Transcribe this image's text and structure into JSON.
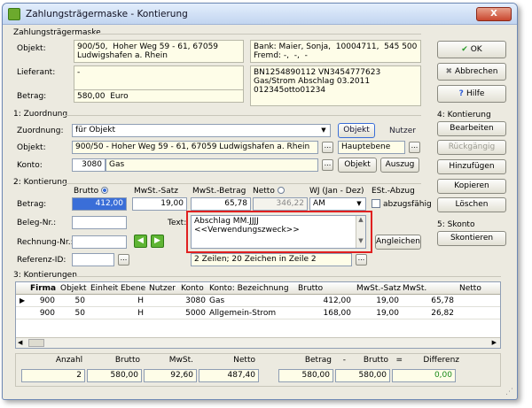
{
  "title": "Zahlungsträgermaske - Kontierung",
  "close": "X",
  "zm": {
    "group": "Zahlungsträgermaske",
    "objekt_label": "Objekt:",
    "objekt_value": "900/50,  Hoher Weg 59 - 61, 67059\nLudwigshafen a. Rhein",
    "bank_value": "Bank: Maier, Sonja,  10004711,  545 500 10,  S\nFremd: -,  -,  -",
    "lieferant_label": "Lieferant:",
    "lieferant_value": "-",
    "info_value": "BN1254890112 VN3454777623\nGas/Strom Abschlag 03.2011\n012345otto01234",
    "betrag_label": "Betrag:",
    "betrag_value": "580,00  Euro"
  },
  "z": {
    "group": "1: Zuordnung",
    "zuordnung_label": "Zuordnung:",
    "zuordnung_value": "für Objekt",
    "tab_objekt": "Objekt",
    "tab_nutzer": "Nutzer",
    "objekt_label": "Objekt:",
    "objekt_value": "900/50 - Hoher Weg 59 - 61, 67059 Ludwigshafen a. Rhein",
    "ebene_value": "Hauptebene",
    "konto_label": "Konto:",
    "konto_num": "3080",
    "konto_name": "Gas",
    "objekt_btn": "Objekt",
    "auszug_btn": "Auszug"
  },
  "k": {
    "group": "2: Kontierung",
    "h_brutto": "Brutto",
    "h_mwstsatz": "MwSt.-Satz",
    "h_mwstbetrag": "MwSt.-Betrag",
    "h_netto": "Netto",
    "h_wj": "WJ  (Jan - Dez)",
    "h_est": "ESt.-Abzug",
    "betrag_label": "Betrag:",
    "brutto": "412,00",
    "satz": "19,00",
    "mwst": "65,78",
    "netto": "346,22",
    "wj": "AM",
    "abzug": "abzugsfähig",
    "beleg_label": "Beleg-Nr.:",
    "text_label": "Text:",
    "text_value": "Abschlag MM.JJJJ\n<<Verwendungszweck>>",
    "rechnung_label": "Rechnung-Nr.:",
    "angleichen": "Angleichen",
    "referenz_label": "Referenz-ID:",
    "zeilen_info": "2 Zeilen; 20 Zeichen in Zeile 2"
  },
  "list": {
    "group": "3: Kontierungen",
    "headers": [
      "Firma",
      "Objekt",
      "Einheit",
      "Ebene",
      "Nutzer",
      "Konto",
      "Konto: Bezeichnung",
      "Brutto",
      "MwSt.-Satz",
      "MwSt.",
      "Netto"
    ],
    "rows": [
      {
        "firma": "900",
        "objekt": "50",
        "einheit": "",
        "ebene": "H",
        "nutzer": "",
        "konto": "3080",
        "bez": "Gas",
        "brutto": "412,00",
        "satz": "19,00",
        "mwst": "65,78",
        "netto": ""
      },
      {
        "firma": "900",
        "objekt": "50",
        "einheit": "",
        "ebene": "H",
        "nutzer": "",
        "konto": "5000",
        "bez": "Allgemein-Strom",
        "brutto": "168,00",
        "satz": "19,00",
        "mwst": "26,82",
        "netto": ""
      }
    ]
  },
  "sum": {
    "h_anzahl": "Anzahl",
    "h_brutto": "Brutto",
    "h_mwst": "MwSt.",
    "h_netto": "Netto",
    "h_betrag": "Betrag",
    "h_minus": "-",
    "h_brutto2": "Brutto",
    "h_eq": "=",
    "h_diff": "Differenz",
    "anzahl": "2",
    "brutto": "580,00",
    "mwst": "92,60",
    "netto": "487,40",
    "betrag": "580,00",
    "brutto2": "580,00",
    "diff": "0,00"
  },
  "right": {
    "ok": "OK",
    "abbrechen": "Abbrechen",
    "hilfe": "Hilfe",
    "k_group": "4: Kontierung",
    "bearbeiten": "Bearbeiten",
    "rueck": "Rückgängig",
    "hinzu": "Hinzufügen",
    "kopieren": "Kopieren",
    "loeschen": "Löschen",
    "s_group": "5: Skonto",
    "skontieren": "Skontieren"
  }
}
